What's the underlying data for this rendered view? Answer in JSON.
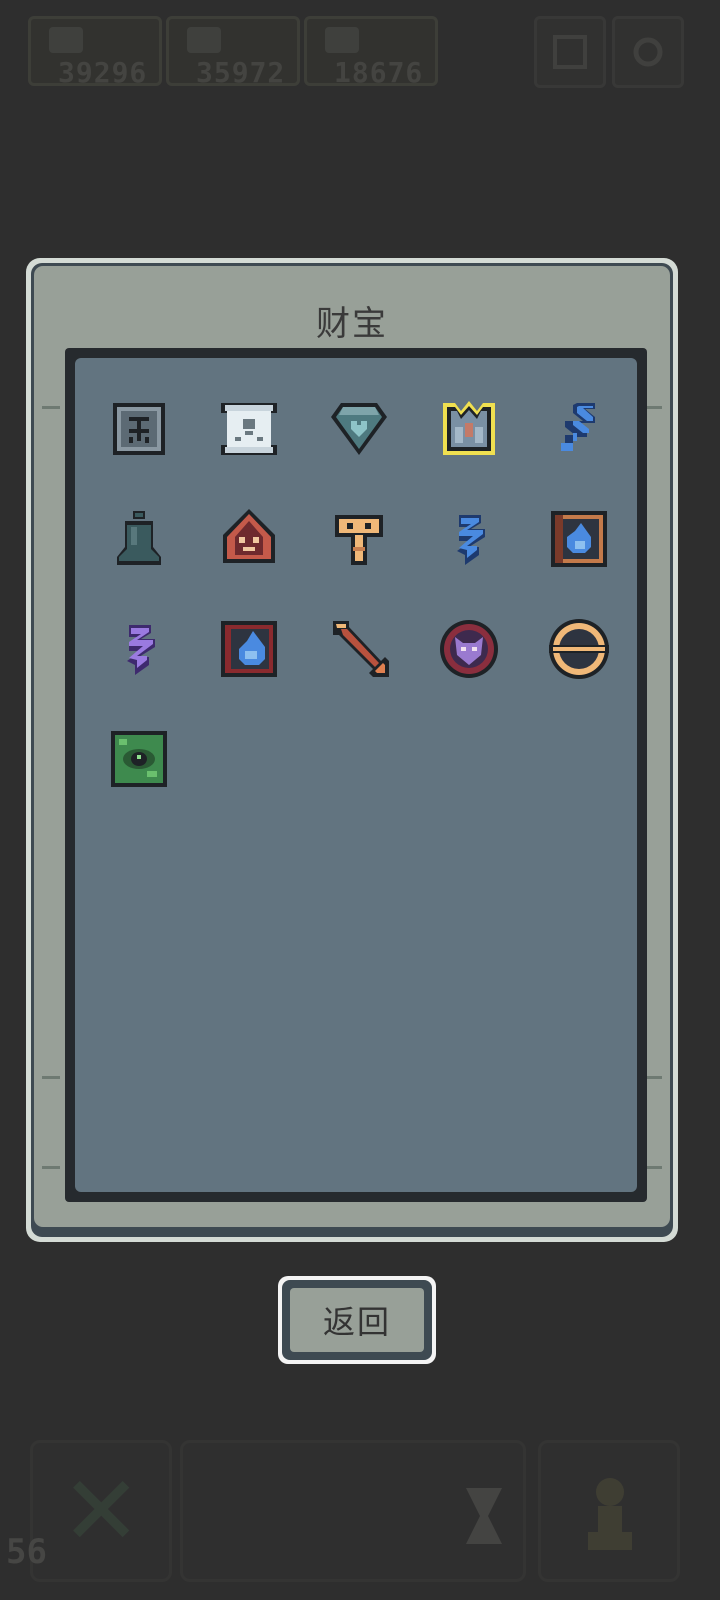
{
  "hud": {
    "resources": [
      {
        "icon": "feather-icon",
        "value": "39296"
      },
      {
        "icon": "pickaxe-icon",
        "value": "35972"
      },
      {
        "icon": "crystal-icon",
        "value": "18676"
      }
    ],
    "top_buttons": [
      "grid-icon",
      "settings-icon"
    ],
    "bottom_left_count": "56"
  },
  "panel": {
    "title": "财宝",
    "items": [
      {
        "name": "rune-tablet-icon",
        "selected": false
      },
      {
        "name": "skull-scroll-icon",
        "selected": false
      },
      {
        "name": "heart-gem-icon",
        "selected": false
      },
      {
        "name": "crystal-crown-icon",
        "selected": true
      },
      {
        "name": "blue-wind-icon",
        "selected": false
      },
      {
        "name": "iron-bell-icon",
        "selected": false
      },
      {
        "name": "crimson-mask-icon",
        "selected": false
      },
      {
        "name": "golden-key-icon",
        "selected": false
      },
      {
        "name": "blue-lightning-icon",
        "selected": false
      },
      {
        "name": "blue-flame-tome-icon",
        "selected": false
      },
      {
        "name": "purple-lightning-icon",
        "selected": false
      },
      {
        "name": "blue-flame-card-icon",
        "selected": false
      },
      {
        "name": "copper-arrow-icon",
        "selected": false
      },
      {
        "name": "demon-orb-icon",
        "selected": false
      },
      {
        "name": "golden-ring-icon",
        "selected": false
      },
      {
        "name": "jade-eye-icon",
        "selected": false
      }
    ]
  },
  "return_button": {
    "label": "返回"
  },
  "colors": {
    "background": "#2e2e2e",
    "panel_face": "#98a098",
    "content_area": "#627480",
    "selected_outline": "#f0e050"
  }
}
